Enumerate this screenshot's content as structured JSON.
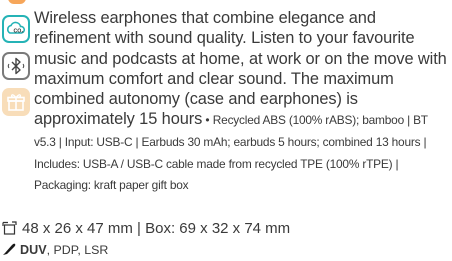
{
  "description": {
    "lead": "Wireless earphones that combine elegance and refinement with sound quality. Listen to your favourite music and podcasts at home, at work or on the move with maximum comfort and clear sound. The maximum combined autonomy (case and earphones) is approximately 15 hours",
    "bullet": " • ",
    "specs": "Recycled ABS (100% rABS); bamboo | BT v5.3 | Input: USB-C | Earbuds 30 mAh; earbuds 5 hours; combined 13 hours | Includes: USB-A / USB-C cable made from recycled TPE (100% rTPE) | Packaging: kraft paper gift box"
  },
  "dimensions": "48 x 26 x 47 mm | Box: 69 x 32 x 74 mm",
  "techniques": {
    "primary": "DUV",
    "others": ", PDP, LSR"
  },
  "icons": {
    "co2": {
      "name": "co2-cloud-icon",
      "color": "#25b3b6",
      "label": "CO₂"
    },
    "bluetooth": {
      "name": "bluetooth-icon",
      "color": "#7a7a7a"
    },
    "gift": {
      "name": "gift-box-icon",
      "color": "#f2b46a"
    },
    "dimensions": {
      "name": "dimensions-icon"
    },
    "print": {
      "name": "print-technique-icon"
    }
  }
}
